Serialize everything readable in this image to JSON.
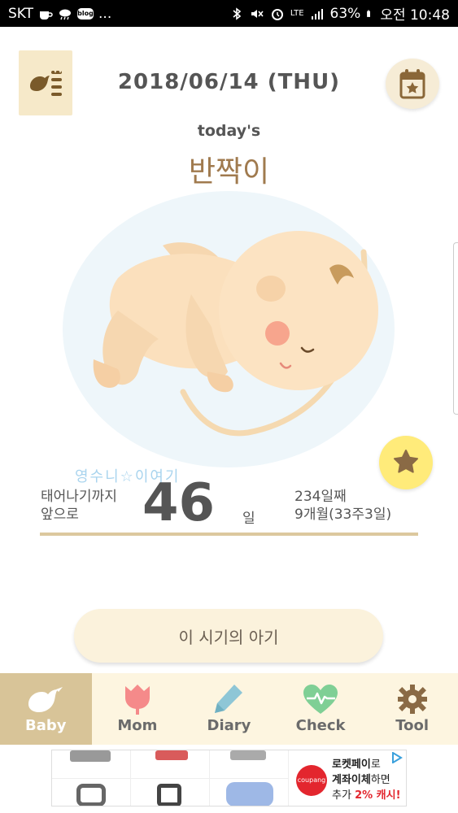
{
  "status_bar": {
    "carrier": "SKT",
    "battery": "63%",
    "time": "오전 10:48",
    "network": "LTE",
    "icons": [
      "coffee-icon",
      "weather-icon",
      "blog-icon",
      "more-icon",
      "bluetooth-icon",
      "mute-icon",
      "alarm-icon",
      "signal-icon",
      "battery-icon"
    ],
    "blog_badge": "blog",
    "more": "..."
  },
  "header": {
    "date": "2018/06/14 (THU)",
    "todays_label": "today's",
    "baby_name": "반짝이"
  },
  "watermark": "영수니☆이여기",
  "dday": {
    "label_line1": "태어나기까지",
    "label_line2": "앞으로",
    "days_left": "46",
    "unit": "일",
    "day_count": "234일째",
    "age": "9개월(33주3일)"
  },
  "period_button": "이 시기의 아기",
  "tabs": [
    {
      "label": "Baby",
      "icon": "bird-icon",
      "active": true
    },
    {
      "label": "Mom",
      "icon": "tulip-icon",
      "active": false
    },
    {
      "label": "Diary",
      "icon": "pencil-icon",
      "active": false
    },
    {
      "label": "Check",
      "icon": "heart-pulse-icon",
      "active": false
    },
    {
      "label": "Tool",
      "icon": "gear-icon",
      "active": false
    }
  ],
  "ad": {
    "brand": "coupang",
    "line1_bold": "로켓페이",
    "line1_rest": "로",
    "line2_bold": "계좌이체",
    "line2_rest": "하면",
    "line3_pre": "추가 ",
    "line3_red": "2% 캐시!"
  },
  "colors": {
    "accent_tan": "#d8c498",
    "tab_bg": "#fdf5e0",
    "name_brown": "#a07a4e",
    "star_yellow": "#ffeb7a"
  }
}
